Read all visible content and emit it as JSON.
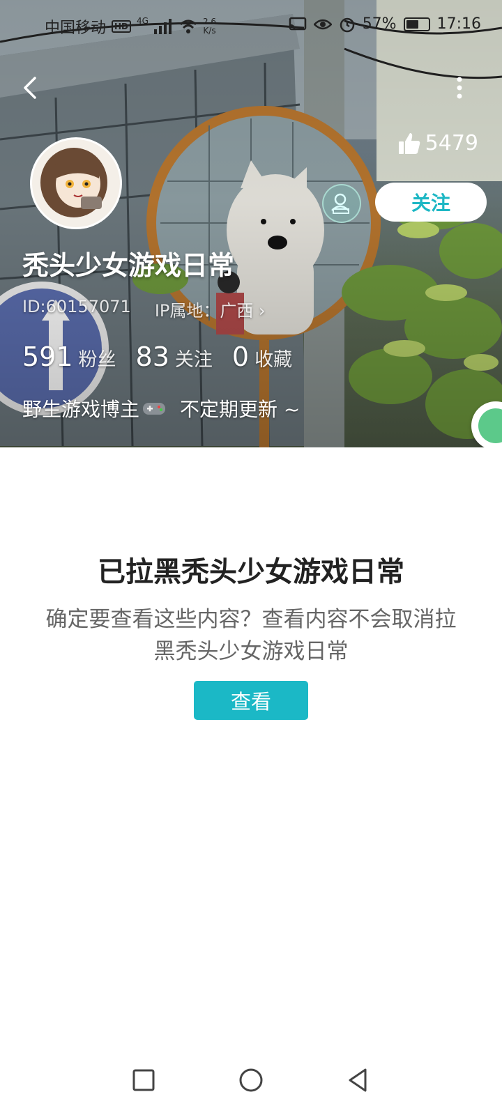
{
  "status_bar": {
    "carrier": "中国移动",
    "hd_badge": "HD",
    "network": "4G",
    "speed_value": "2.6",
    "speed_unit": "K/s",
    "battery": "57%",
    "battery_level": 0.57,
    "time": "17:16"
  },
  "profile": {
    "likes": "5479",
    "follow_label": "关注",
    "username": "秃头少女游戏日常",
    "id_text": "ID:60157071",
    "ip_text": "IP属地：广西",
    "stats": [
      {
        "value": "591",
        "label": "粉丝"
      },
      {
        "value": "83",
        "label": "关注"
      },
      {
        "value": "0",
        "label": "收藏"
      }
    ],
    "bio_part1": "野生游戏博主",
    "bio_part2": "不定期更新 ~"
  },
  "blocked": {
    "title": "已拉黑秃头少女游戏日常",
    "description": "确定要查看这些内容？查看内容不会取消拉黑秃头少女游戏日常",
    "view_button": "查看"
  },
  "icons": [
    "back-icon",
    "more-icon",
    "thumbs-up-icon",
    "gamepad-icon",
    "recent-apps-icon",
    "home-icon",
    "back-nav-icon"
  ]
}
